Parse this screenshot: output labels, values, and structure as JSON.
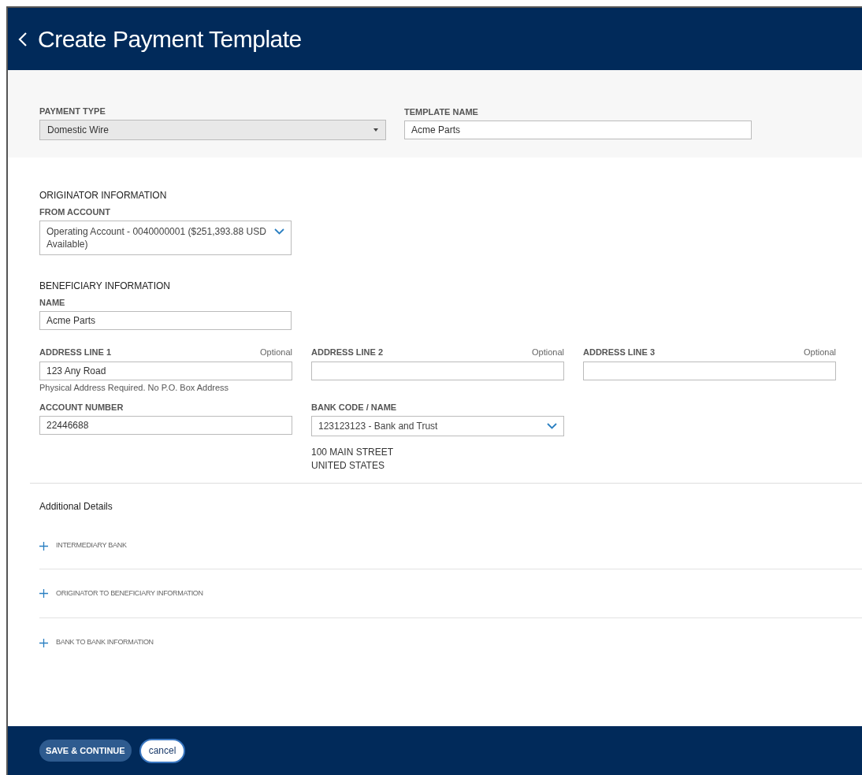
{
  "header": {
    "title": "Create Payment Template"
  },
  "template": {
    "payment_type": {
      "label": "PAYMENT TYPE",
      "value": "Domestic Wire"
    },
    "template_name": {
      "label": "TEMPLATE NAME",
      "value": "Acme Parts"
    }
  },
  "originator": {
    "heading": "ORIGINATOR INFORMATION",
    "from_account": {
      "label": "FROM ACCOUNT",
      "value": "Operating Account - 0040000001 ($251,393.88 USD Available)"
    }
  },
  "beneficiary": {
    "heading": "BENEFICIARY INFORMATION",
    "name": {
      "label": "NAME",
      "value": "Acme Parts"
    },
    "address_fields": [
      {
        "label": "ADDRESS LINE 1",
        "note": "Optional",
        "value": "123 Any Road",
        "hint": "Physical Address Required. No P.O. Box Address"
      },
      {
        "label": "ADDRESS LINE 2",
        "note": "Optional"
      },
      {
        "label": "ADDRESS LINE 3",
        "note": "Optional"
      }
    ],
    "account_number": {
      "label": "ACCOUNT NUMBER",
      "value": "22446688"
    },
    "bank_code": {
      "label": "BANK CODE / NAME",
      "value": "123123123 - Bank and Trust",
      "address_lines": [
        "100 MAIN STREET",
        "UNITED STATES"
      ]
    }
  },
  "additional": {
    "heading": "Additional Details",
    "sections": [
      {
        "label": "INTERMEDIARY BANK",
        "expanded": false
      },
      {
        "label": "ORIGINATOR TO BENEFICIARY INFORMATION",
        "expanded": false
      },
      {
        "label": "BANK TO BANK INFORMATION",
        "expanded": false
      }
    ]
  },
  "footer": {
    "buttons": [
      {
        "label": "SAVE & CONTINUE",
        "kind": "primary"
      },
      {
        "label": "cancel",
        "kind": "secondary"
      }
    ]
  }
}
